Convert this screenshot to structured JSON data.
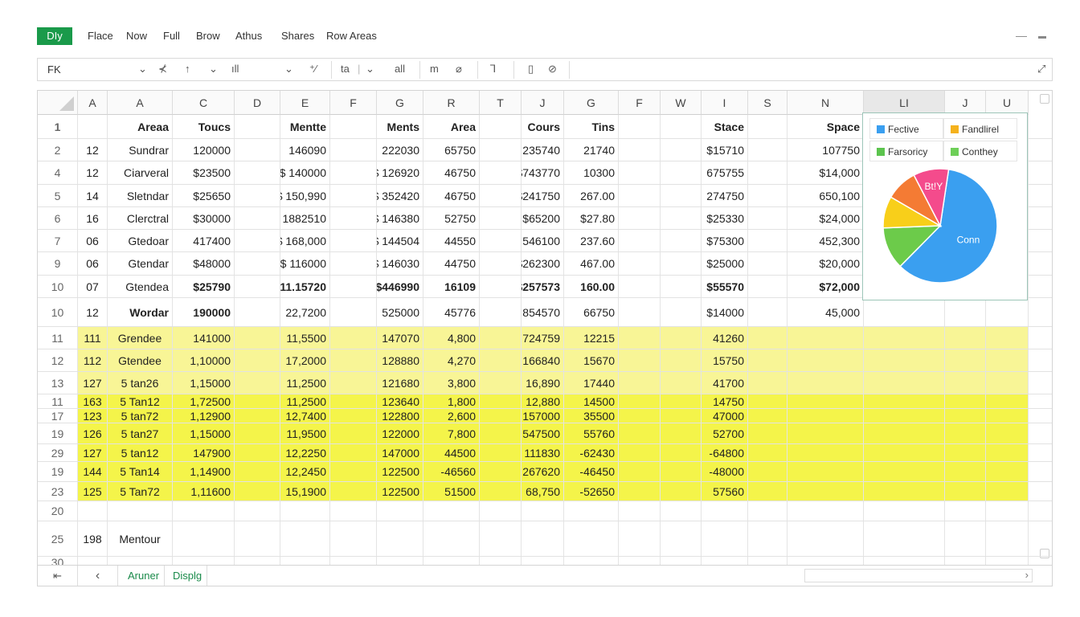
{
  "ribbon": {
    "app_label": "DIy",
    "menu": [
      "Flace",
      "Now",
      "Full",
      "Brow",
      "Athus",
      "Shares",
      "Row Areas"
    ],
    "minimize": "—",
    "restore": "▬"
  },
  "toolbar": {
    "name_box": "FK",
    "items": [
      "⌄",
      "⊀",
      "↑",
      "⌄",
      "ıll",
      "⌄",
      "⁺⁄",
      "ta",
      "|",
      "⌄",
      "all",
      "m",
      "⌀",
      "⅂",
      "▯",
      "⊘"
    ],
    "expand_icon": "⤢"
  },
  "columns": [
    "A",
    "A",
    "C",
    "D",
    "E",
    "F",
    "G",
    "R",
    "T",
    "J",
    "G",
    "F",
    "W",
    "I",
    "S",
    "N",
    "LI",
    "J",
    "U"
  ],
  "rows": [
    {
      "num": "1",
      "style": "hdr",
      "cells": [
        "",
        "Areaa",
        "Toucs",
        "",
        "Mentte",
        "",
        "Ments",
        "Area",
        "",
        "Cours",
        "Tins",
        "",
        "",
        "Stace",
        "",
        "Space",
        "",
        "",
        ""
      ]
    },
    {
      "num": "2",
      "cells": [
        "12",
        "Sundrar",
        "120000",
        "",
        "146090",
        "",
        "222030",
        "65750",
        "",
        "235740",
        "21740",
        "",
        "",
        "$15710",
        "",
        "107750",
        "",
        "",
        ""
      ]
    },
    {
      "num": "4",
      "cells": [
        "12",
        "Ciarveral",
        "$23500",
        "",
        "$ 140000",
        "",
        "$ 126920",
        "46750",
        "",
        "$743770",
        "10300",
        "",
        "",
        "675755",
        "",
        "$14,000",
        "",
        "",
        ""
      ]
    },
    {
      "num": "5",
      "cells": [
        "14",
        "Sletndar",
        "$25650",
        "",
        "$ 150,990",
        "",
        "$ 352420",
        "46750",
        "",
        "$241750",
        "267.00",
        "",
        "",
        "274750",
        "",
        "650,100",
        "",
        "",
        ""
      ]
    },
    {
      "num": "6",
      "cells": [
        "16",
        "Clerctral",
        "$30000",
        "",
        "$ 1882510",
        "",
        "$ 146380",
        "52750",
        "",
        "$65200",
        "$27.80",
        "",
        "",
        "$25330",
        "",
        "$24,000",
        "",
        "",
        ""
      ]
    },
    {
      "num": "7",
      "cells": [
        "06",
        "Gtedoar",
        "417400",
        "",
        "$ 168,000",
        "",
        "$ 144504",
        "44550",
        "",
        "546100",
        "237.60",
        "",
        "",
        "$75300",
        "",
        "452,300",
        "",
        "",
        ""
      ]
    },
    {
      "num": "9",
      "cells": [
        "06",
        "Gtendar",
        "$48000",
        "",
        "$ 116000",
        "",
        "$ 146030",
        "44750",
        "",
        "$262300",
        "467.00",
        "",
        "",
        "$25000",
        "",
        "$20,000",
        "",
        "",
        ""
      ]
    },
    {
      "num": "10",
      "style": "boldvals",
      "cells": [
        "07",
        "Gtendea",
        "$25790",
        "",
        "$11.15720",
        "",
        "$446990",
        "16109",
        "",
        "$257573",
        "160.00",
        "",
        "",
        "$55570",
        "",
        "$72,000",
        "",
        "",
        ""
      ]
    },
    {
      "num": "10",
      "style": "boldname",
      "cells": [
        "12",
        "Wordar",
        "190000",
        "",
        "22,7200",
        "",
        "525000",
        "45776",
        "",
        "854570",
        "66750",
        "",
        "",
        "$14000",
        "",
        "45,000",
        "",
        "",
        ""
      ]
    },
    {
      "num": "11",
      "style": "hl",
      "cells": [
        "111",
        "Grendee",
        "141000",
        "",
        "11,5500",
        "",
        "147070",
        "4,800",
        "",
        "724759",
        "12215",
        "",
        "",
        "41260",
        "",
        "",
        "",
        "",
        ""
      ]
    },
    {
      "num": "12",
      "style": "hl",
      "cells": [
        "112",
        "Gtendee",
        "1,10000",
        "",
        "17,2000",
        "",
        "128880",
        "4,270",
        "",
        "166840",
        "15670",
        "",
        "",
        "15750",
        "",
        "",
        "",
        "",
        ""
      ]
    },
    {
      "num": "13",
      "style": "hl",
      "cells": [
        "127",
        "5 tan26",
        "1,15000",
        "",
        "11,2500",
        "",
        "121680",
        "3,800",
        "",
        "16,890",
        "17440",
        "",
        "",
        "41700",
        "",
        "",
        "",
        "",
        ""
      ]
    },
    {
      "num": "11",
      "style": "hl2",
      "cells": [
        "163",
        "5 Tan12",
        "1,72500",
        "",
        "11,2500",
        "",
        "123640",
        "1,800",
        "",
        "12,880",
        "14500",
        "",
        "",
        "14750",
        "",
        "",
        "",
        "",
        ""
      ]
    },
    {
      "num": "17",
      "style": "hl2",
      "cells": [
        "123",
        "5 tan72",
        "1,12900",
        "",
        "12,7400",
        "",
        "122800",
        "2,600",
        "",
        "157000",
        "35500",
        "",
        "",
        "47000",
        "",
        "",
        "",
        "",
        ""
      ]
    },
    {
      "num": "19",
      "style": "hl2",
      "cells": [
        "126",
        "5 tan27",
        "1,15000",
        "",
        "11,9500",
        "",
        "122000",
        "7,800",
        "",
        "547500",
        "55760",
        "",
        "",
        "52700",
        "",
        "",
        "",
        "",
        ""
      ]
    },
    {
      "num": "29",
      "style": "hl2",
      "cells": [
        "127",
        "5 tan12",
        "147900",
        "",
        "12,2250",
        "",
        "147000",
        "44500",
        "",
        "111830",
        "-62430",
        "",
        "",
        "-64800",
        "",
        "",
        "",
        "",
        ""
      ]
    },
    {
      "num": "19",
      "style": "hl2",
      "cells": [
        "144",
        "5 Tan14",
        "1,14900",
        "",
        "12,2450",
        "",
        "122500",
        "-46560",
        "",
        "267620",
        "-46450",
        "",
        "",
        "-48000",
        "",
        "",
        "",
        "",
        ""
      ]
    },
    {
      "num": "23",
      "style": "hl2",
      "cells": [
        "125",
        "5 Tan72",
        "1,11600",
        "",
        "15,1900",
        "",
        "122500",
        "51500",
        "",
        "68,750",
        "-52650",
        "",
        "",
        "57560",
        "",
        "",
        "",
        "",
        ""
      ]
    },
    {
      "num": "20",
      "cells": [
        "",
        "",
        "",
        "",
        "",
        "",
        "",
        "",
        "",
        "",
        "",
        "",
        "",
        "",
        "",
        "",
        "",
        "",
        ""
      ]
    },
    {
      "num": "25",
      "style": "mentour",
      "cells": [
        "198",
        "Mentour",
        "",
        "",
        "",
        "",
        "",
        "",
        "",
        "",
        "",
        "",
        "",
        "",
        "",
        "",
        "",
        "",
        ""
      ]
    },
    {
      "num": "30",
      "cells": [
        "",
        "",
        "",
        "",
        "",
        "",
        "",
        "",
        "",
        "",
        "",
        "",
        "",
        "",
        "",
        "",
        "",
        "",
        ""
      ]
    }
  ],
  "chart": {
    "legend": [
      {
        "label": "Fective",
        "color": "#3a9ff0"
      },
      {
        "label": "Fandlirel",
        "color": "#f5b21c"
      },
      {
        "label": "Farsoricy",
        "color": "#5cc44e"
      },
      {
        "label": "Conthey",
        "color": "#6ecf58"
      }
    ],
    "slice_labels": {
      "pink": "Bt!Y",
      "blue": "Conn"
    }
  },
  "chart_data": {
    "type": "pie",
    "slices": [
      {
        "name": "Conn",
        "value": 60,
        "color": "#3a9ff0"
      },
      {
        "name": "",
        "value": 12,
        "color": "#6ccb4a"
      },
      {
        "name": "",
        "value": 9,
        "color": "#f8cf1a"
      },
      {
        "name": "",
        "value": 9,
        "color": "#f47b34"
      },
      {
        "name": "Bt!Y",
        "value": 10,
        "color": "#f44b8c"
      }
    ]
  },
  "tabs": {
    "nav_first": "⇤",
    "nav_prev": "‹",
    "sheets": [
      "Aruner",
      "Displg"
    ],
    "scroll_right": "›"
  }
}
